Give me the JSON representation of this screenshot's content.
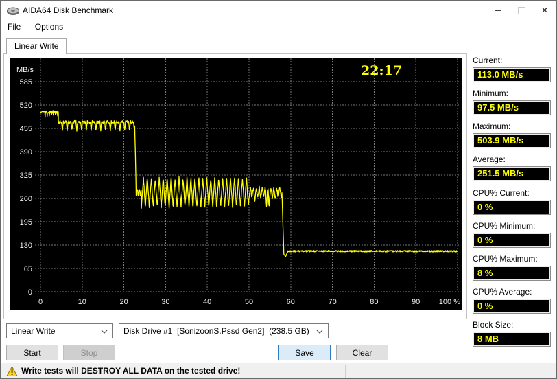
{
  "window": {
    "title": "AIDA64 Disk Benchmark",
    "controls": {
      "minimize": "─",
      "maximize": "▢",
      "close": "✕"
    }
  },
  "menu": {
    "items": [
      "File",
      "Options"
    ]
  },
  "tabs": {
    "active": "Linear Write"
  },
  "icons": {
    "app_icon": "disk-platter",
    "minimize_icon": "─",
    "maximize_icon": "▢",
    "close_icon": "✕",
    "warning_icon": "⚠",
    "dropdown_chevron": "⌄"
  },
  "chart_data": {
    "type": "line",
    "title": "Linear Write",
    "time_label": "22:17",
    "ylabel": "MB/s",
    "xlabel": "",
    "x_unit": "%",
    "y_ticks": [
      585,
      520,
      455,
      390,
      325,
      260,
      195,
      130,
      65,
      0
    ],
    "x_ticks": [
      "0",
      "10",
      "20",
      "30",
      "40",
      "50",
      "60",
      "70",
      "80",
      "90",
      "100 %"
    ],
    "y_range": [
      0,
      650
    ],
    "x_range_percent": [
      0,
      100
    ],
    "grid": "dashed",
    "legend_position": "none",
    "series_color": "#ffff00",
    "grid_color": "#7a7a7a",
    "label_color": "#f2f2f2",
    "seed": 11,
    "sample_step_percent": 0.07,
    "phases": [
      {
        "mode": "ramp",
        "x0": 0,
        "x1": 0.7,
        "v0": 499,
        "v1": 503.9
      },
      {
        "mode": "sawdown",
        "x0": 0.7,
        "x1": 4.3,
        "hi": 504,
        "lo": 487,
        "period": 0.5
      },
      {
        "mode": "sawdown",
        "x0": 4.3,
        "x1": 22.6,
        "hi": 476,
        "lo": 447,
        "period": 1.15
      },
      {
        "mode": "ramp",
        "x0": 22.6,
        "x1": 22.95,
        "v0": 462,
        "v1": 280
      },
      {
        "mode": "saw",
        "x0": 22.95,
        "x1": 24.2,
        "hi": 289,
        "lo": 267,
        "period": 0.5
      },
      {
        "mode": "saw",
        "x0": 24.2,
        "x1": 50.0,
        "hi": 318,
        "lo": 236,
        "period": 0.95
      },
      {
        "mode": "saw",
        "x0": 50.0,
        "x1": 57.9,
        "hi": 290,
        "lo": 263,
        "period": 0.7,
        "dips": [
          [
            51.4,
            252
          ],
          [
            54.2,
            238
          ],
          [
            54.8,
            234
          ],
          [
            56.3,
            260
          ]
        ]
      },
      {
        "mode": "ramp",
        "x0": 57.9,
        "x1": 58.35,
        "v0": 276,
        "v1": 105
      },
      {
        "mode": "vee",
        "x0": 58.35,
        "x1": 59.2,
        "v0": 105,
        "vmin": 97.5,
        "v1": 110
      },
      {
        "mode": "noise",
        "x0": 59.2,
        "x1": 100,
        "base": 113,
        "amp": 2.2
      }
    ]
  },
  "stats": {
    "items": [
      {
        "label": "Current:",
        "value": "113.0 MB/s"
      },
      {
        "label": "Minimum:",
        "value": "97.5 MB/s"
      },
      {
        "label": "Maximum:",
        "value": "503.9 MB/s"
      },
      {
        "label": "Average:",
        "value": "251.5 MB/s"
      },
      {
        "label": "CPU% Current:",
        "value": "0 %"
      },
      {
        "label": "CPU% Minimum:",
        "value": "0 %"
      },
      {
        "label": "CPU% Maximum:",
        "value": "8 %"
      },
      {
        "label": "CPU% Average:",
        "value": "0 %"
      },
      {
        "label": "Block Size:",
        "value": "8 MB"
      }
    ]
  },
  "controls": {
    "test_type": {
      "value": "Linear Write"
    },
    "drive": {
      "value": "Disk Drive #1  [SonizoonS.Pssd Gen2]  (238.5 GB)"
    },
    "buttons": {
      "start": "Start",
      "stop": "Stop",
      "save": "Save",
      "clear": "Clear"
    }
  },
  "statusbar": {
    "message": "Write tests will DESTROY ALL DATA on the tested drive!"
  },
  "colors": {
    "accent_yellow": "#ffff00",
    "chart_bg": "#000000",
    "save_border": "#2e7bbf"
  }
}
